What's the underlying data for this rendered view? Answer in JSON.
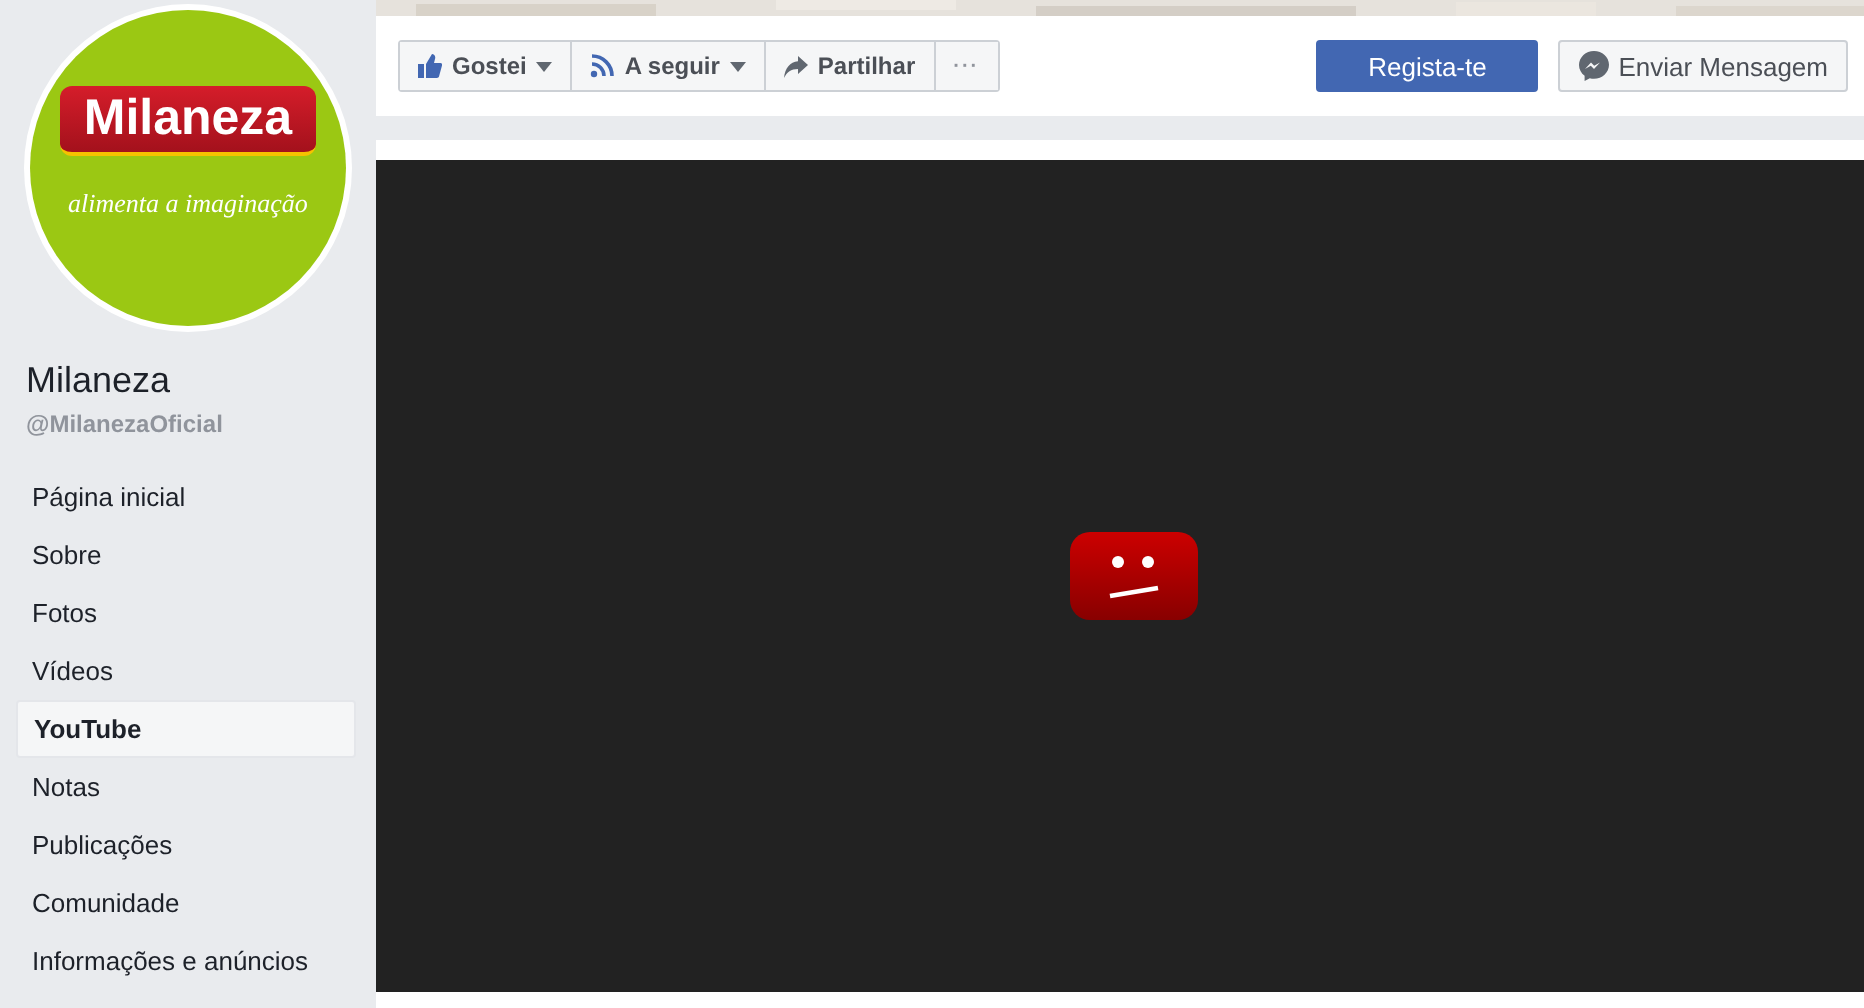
{
  "profile": {
    "logo_name": "Milaneza",
    "logo_tagline": "alimenta a imaginação",
    "name": "Milaneza",
    "handle": "@MilanezaOficial"
  },
  "nav": [
    {
      "label": "Página inicial",
      "selected": false
    },
    {
      "label": "Sobre",
      "selected": false
    },
    {
      "label": "Fotos",
      "selected": false
    },
    {
      "label": "Vídeos",
      "selected": false
    },
    {
      "label": "YouTube",
      "selected": true
    },
    {
      "label": "Notas",
      "selected": false
    },
    {
      "label": "Publicações",
      "selected": false
    },
    {
      "label": "Comunidade",
      "selected": false
    },
    {
      "label": "Informações e anúncios",
      "selected": false
    }
  ],
  "actions": [
    {
      "kind": "like",
      "label": "Gostei",
      "dropdown": true
    },
    {
      "kind": "follow",
      "label": "A seguir",
      "dropdown": true
    },
    {
      "kind": "share",
      "label": "Partilhar",
      "dropdown": false
    },
    {
      "kind": "more",
      "label": "···",
      "dropdown": false
    }
  ],
  "signup": "Regista-te",
  "message": "Enviar Mensagem"
}
